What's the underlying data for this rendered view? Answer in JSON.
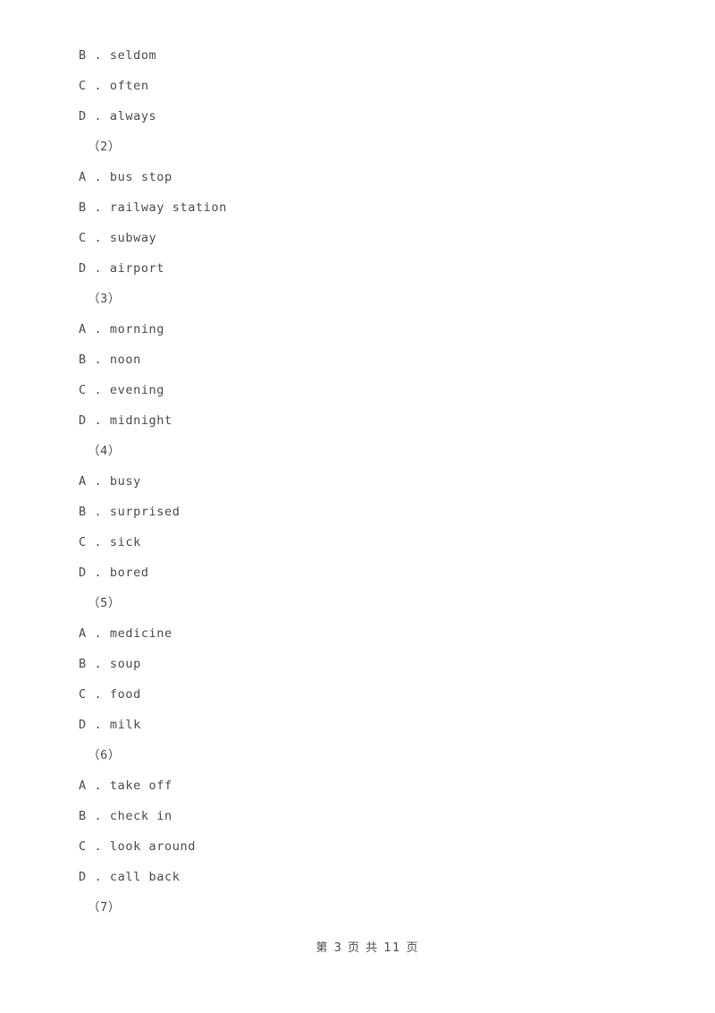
{
  "document": {
    "page_background": "#ffffff",
    "text_color": "#4a4a4a",
    "separator": " . "
  },
  "blocks": [
    {
      "kind": "option",
      "letter": "B",
      "text": "seldom"
    },
    {
      "kind": "option",
      "letter": "C",
      "text": "often"
    },
    {
      "kind": "option",
      "letter": "D",
      "text": "always"
    },
    {
      "kind": "question",
      "label": "（2）"
    },
    {
      "kind": "option",
      "letter": "A",
      "text": "bus stop"
    },
    {
      "kind": "option",
      "letter": "B",
      "text": "railway station"
    },
    {
      "kind": "option",
      "letter": "C",
      "text": "subway"
    },
    {
      "kind": "option",
      "letter": "D",
      "text": "airport"
    },
    {
      "kind": "question",
      "label": "（3）"
    },
    {
      "kind": "option",
      "letter": "A",
      "text": "morning"
    },
    {
      "kind": "option",
      "letter": "B",
      "text": "noon"
    },
    {
      "kind": "option",
      "letter": "C",
      "text": "evening"
    },
    {
      "kind": "option",
      "letter": "D",
      "text": "midnight"
    },
    {
      "kind": "question",
      "label": "（4）"
    },
    {
      "kind": "option",
      "letter": "A",
      "text": "busy"
    },
    {
      "kind": "option",
      "letter": "B",
      "text": "surprised"
    },
    {
      "kind": "option",
      "letter": "C",
      "text": "sick"
    },
    {
      "kind": "option",
      "letter": "D",
      "text": "bored"
    },
    {
      "kind": "question",
      "label": "（5）"
    },
    {
      "kind": "option",
      "letter": "A",
      "text": "medicine"
    },
    {
      "kind": "option",
      "letter": "B",
      "text": "soup"
    },
    {
      "kind": "option",
      "letter": "C",
      "text": "food"
    },
    {
      "kind": "option",
      "letter": "D",
      "text": "milk"
    },
    {
      "kind": "question",
      "label": "（6）"
    },
    {
      "kind": "option",
      "letter": "A",
      "text": "take off"
    },
    {
      "kind": "option",
      "letter": "B",
      "text": "check in"
    },
    {
      "kind": "option",
      "letter": "C",
      "text": "look around"
    },
    {
      "kind": "option",
      "letter": "D",
      "text": "call back"
    },
    {
      "kind": "question",
      "label": "（7）"
    }
  ],
  "footer": {
    "text": "第 3 页 共 11 页",
    "current_page": "3",
    "total_pages": "11"
  }
}
